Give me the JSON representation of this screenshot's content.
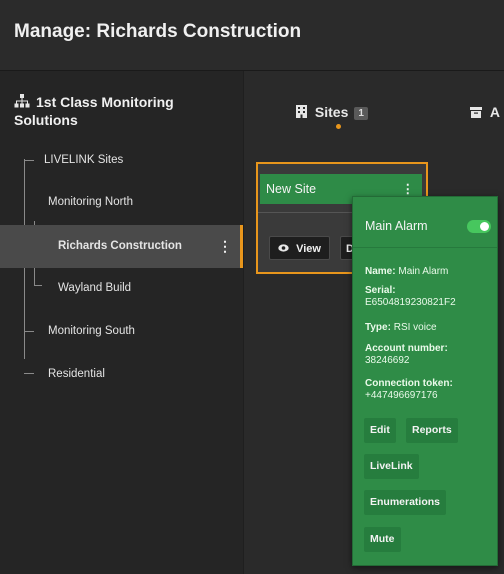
{
  "header": {
    "title": "Manage: Richards Construction"
  },
  "sidebar": {
    "org_name": "1st Class Monitoring Solutions",
    "tree": [
      {
        "label": "LIVELINK Sites"
      },
      {
        "label": "Monitoring North"
      },
      {
        "label": "Richards Construction",
        "selected": true
      },
      {
        "label": "Wayland Build"
      },
      {
        "label": "Monitoring South"
      },
      {
        "label": "Residential"
      }
    ],
    "kebab": "⋮"
  },
  "tabs": [
    {
      "label": "Sites",
      "count": "1",
      "icon": "building-icon",
      "active": true
    },
    {
      "label": "A",
      "icon": "archive-icon"
    }
  ],
  "site_card": {
    "name": "New Site",
    "menu": "⋮",
    "view_button": "View",
    "second_button": "D"
  },
  "alarm_popup": {
    "title": "Main Alarm",
    "enabled": true,
    "fields": [
      {
        "key": "Name:",
        "value": "Main Alarm"
      },
      {
        "key": "Serial:",
        "value": "E6504819230821F2"
      },
      {
        "key": "Type:",
        "value": "RSI voice"
      },
      {
        "key": "Account number:",
        "value": "38246692"
      },
      {
        "key": "Connection token:",
        "value": "+447496697176"
      }
    ],
    "buttons": {
      "edit": "Edit",
      "reports": "Reports",
      "livelink": "LiveLink",
      "enumerations": "Enumerations",
      "mute": "Mute"
    }
  },
  "colors": {
    "accent": "#e8961c",
    "site_green": "#2e8b47",
    "toggle_on": "#47c75e"
  }
}
